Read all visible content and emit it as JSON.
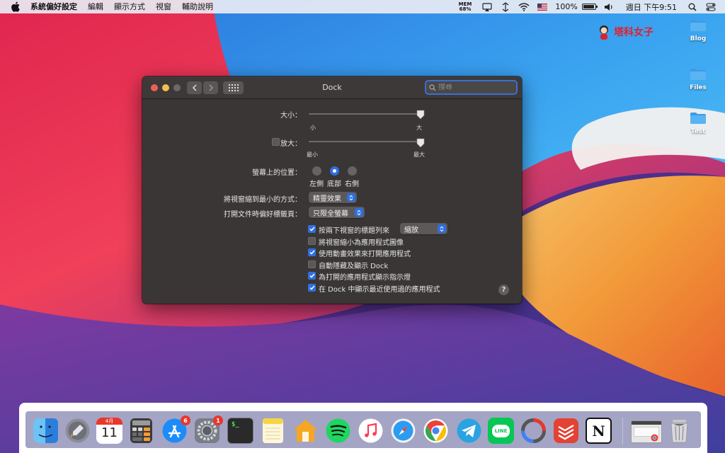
{
  "menubar": {
    "app_name": "系統偏好設定",
    "menus": [
      "編輯",
      "顯示方式",
      "視窗",
      "輔助說明"
    ],
    "mem_label": "MEM",
    "mem_value": "68%",
    "battery_percent": "100%",
    "clock": "週日 下午9:51",
    "icons": [
      "apple-icon",
      "airplay-icon",
      "network-icon",
      "wifi-icon",
      "flag-icon",
      "battery-icon",
      "volume-icon",
      "search-icon",
      "control-icon"
    ]
  },
  "desktop": {
    "brand": "塔科女子",
    "folders": [
      "Blog",
      "Files",
      "Test"
    ]
  },
  "window": {
    "title": "Dock",
    "search_placeholder": "搜尋",
    "size": {
      "label": "大小：",
      "min_label": "小",
      "max_label": "大",
      "value": 1.0
    },
    "magnification": {
      "label": "放大：",
      "checked": false,
      "min_label": "最小",
      "max_label": "最大",
      "value": 1.0
    },
    "position": {
      "label": "螢幕上的位置：",
      "options": [
        "左側",
        "底部",
        "右側"
      ],
      "selected": "底部"
    },
    "minimize_effect": {
      "label": "將視窗縮到最小的方式：",
      "value": "精靈效果"
    },
    "prefer_tabs": {
      "label": "打開文件時偏好標籤頁：",
      "value": "只限全螢幕"
    },
    "double_click": {
      "label": "按兩下視窗的標題列來",
      "value": "縮放",
      "checked": true
    },
    "options": [
      {
        "label": "將視窗縮小為應用程式圖像",
        "checked": false
      },
      {
        "label": "使用動畫效果來打開應用程式",
        "checked": true
      },
      {
        "label": "自動隱藏及顯示 Dock",
        "checked": false
      },
      {
        "label": "為打開的應用程式顯示指示燈",
        "checked": true
      },
      {
        "label": "在 Dock 中顯示最近使用過的應用程式",
        "checked": true
      }
    ],
    "help": "?"
  },
  "dock": {
    "calendar_month": "4月",
    "calendar_day": "11",
    "appstore_badge": "6",
    "prefs_badge": "1",
    "terminal_prompt": "$_",
    "line_label": "LINE",
    "notion_label": "N",
    "apps": [
      "finder-icon",
      "launchpad-icon",
      "calendar-icon",
      "calculator-icon",
      "app-store-icon",
      "system-preferences-icon",
      "terminal-icon",
      "notes-icon",
      "home-icon",
      "spotify-icon",
      "music-icon",
      "safari-icon",
      "chrome-icon",
      "telegram-icon",
      "line-icon",
      "screen-capture-icon",
      "todoist-icon",
      "notion-icon",
      "minimized-window-icon",
      "trash-icon"
    ]
  },
  "colors": {
    "accent": "#2f6fe0",
    "window_bg": "#3a3636",
    "close": "#ee5e57",
    "minimize": "#f4be4f",
    "badge": "#e8372c"
  }
}
